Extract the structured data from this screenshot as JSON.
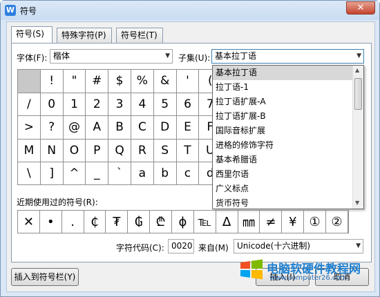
{
  "window": {
    "title": "符号",
    "icon": "W",
    "close": "✕"
  },
  "tabs": [
    {
      "label": "符号(S)"
    },
    {
      "label": "特殊字符(P)"
    },
    {
      "label": "符号栏(T)"
    }
  ],
  "font": {
    "label": "字体(F):",
    "value": "楷体"
  },
  "subset": {
    "label": "子集(U):",
    "value": "基本拉丁语"
  },
  "grid": {
    "rows": [
      [
        "",
        "!",
        "\"",
        "#",
        "$",
        "%",
        "&",
        "'",
        "("
      ],
      [
        "/",
        "0",
        "1",
        "2",
        "3",
        "4",
        "5",
        "6",
        "7"
      ],
      [
        ">",
        "?",
        "@",
        "A",
        "B",
        "C",
        "D",
        "E",
        "F"
      ],
      [
        "M",
        "N",
        "O",
        "P",
        "Q",
        "R",
        "S",
        "T",
        "U"
      ],
      [
        "\\",
        "]",
        "^",
        "_",
        "`",
        "a",
        "b",
        "c",
        "d"
      ]
    ]
  },
  "dropdown": {
    "items": [
      "基本拉丁语",
      "拉丁语-1",
      "拉丁语扩展-A",
      "拉丁语扩展-B",
      "国际音标扩展",
      "进格的修饰字符",
      "基本希腊语",
      "西里尔语",
      "广义标点",
      "货币符号"
    ],
    "selected_index": 0
  },
  "recent": {
    "label": "近期使用过的符号(R):",
    "symbols": [
      "✕",
      "•",
      ".",
      "₵",
      "₮",
      "₲",
      "₾",
      "ɸ",
      "℡",
      "∆",
      "㎜",
      "≠",
      "¥",
      "①",
      "②"
    ]
  },
  "charcode": {
    "label": "字符代码(C):",
    "value": "0020"
  },
  "from": {
    "label": "来自(M)",
    "value": "Unicode(十六进制)"
  },
  "buttons": {
    "insert_bar": "插入到符号栏(Y)",
    "insert": "插入(I)",
    "cancel": "取消"
  },
  "watermark": {
    "title": "电脑软硬件教程网",
    "url": "www.computer26.com"
  },
  "colors": {
    "accent": "#2f7fe0",
    "close": "#c4432d"
  }
}
